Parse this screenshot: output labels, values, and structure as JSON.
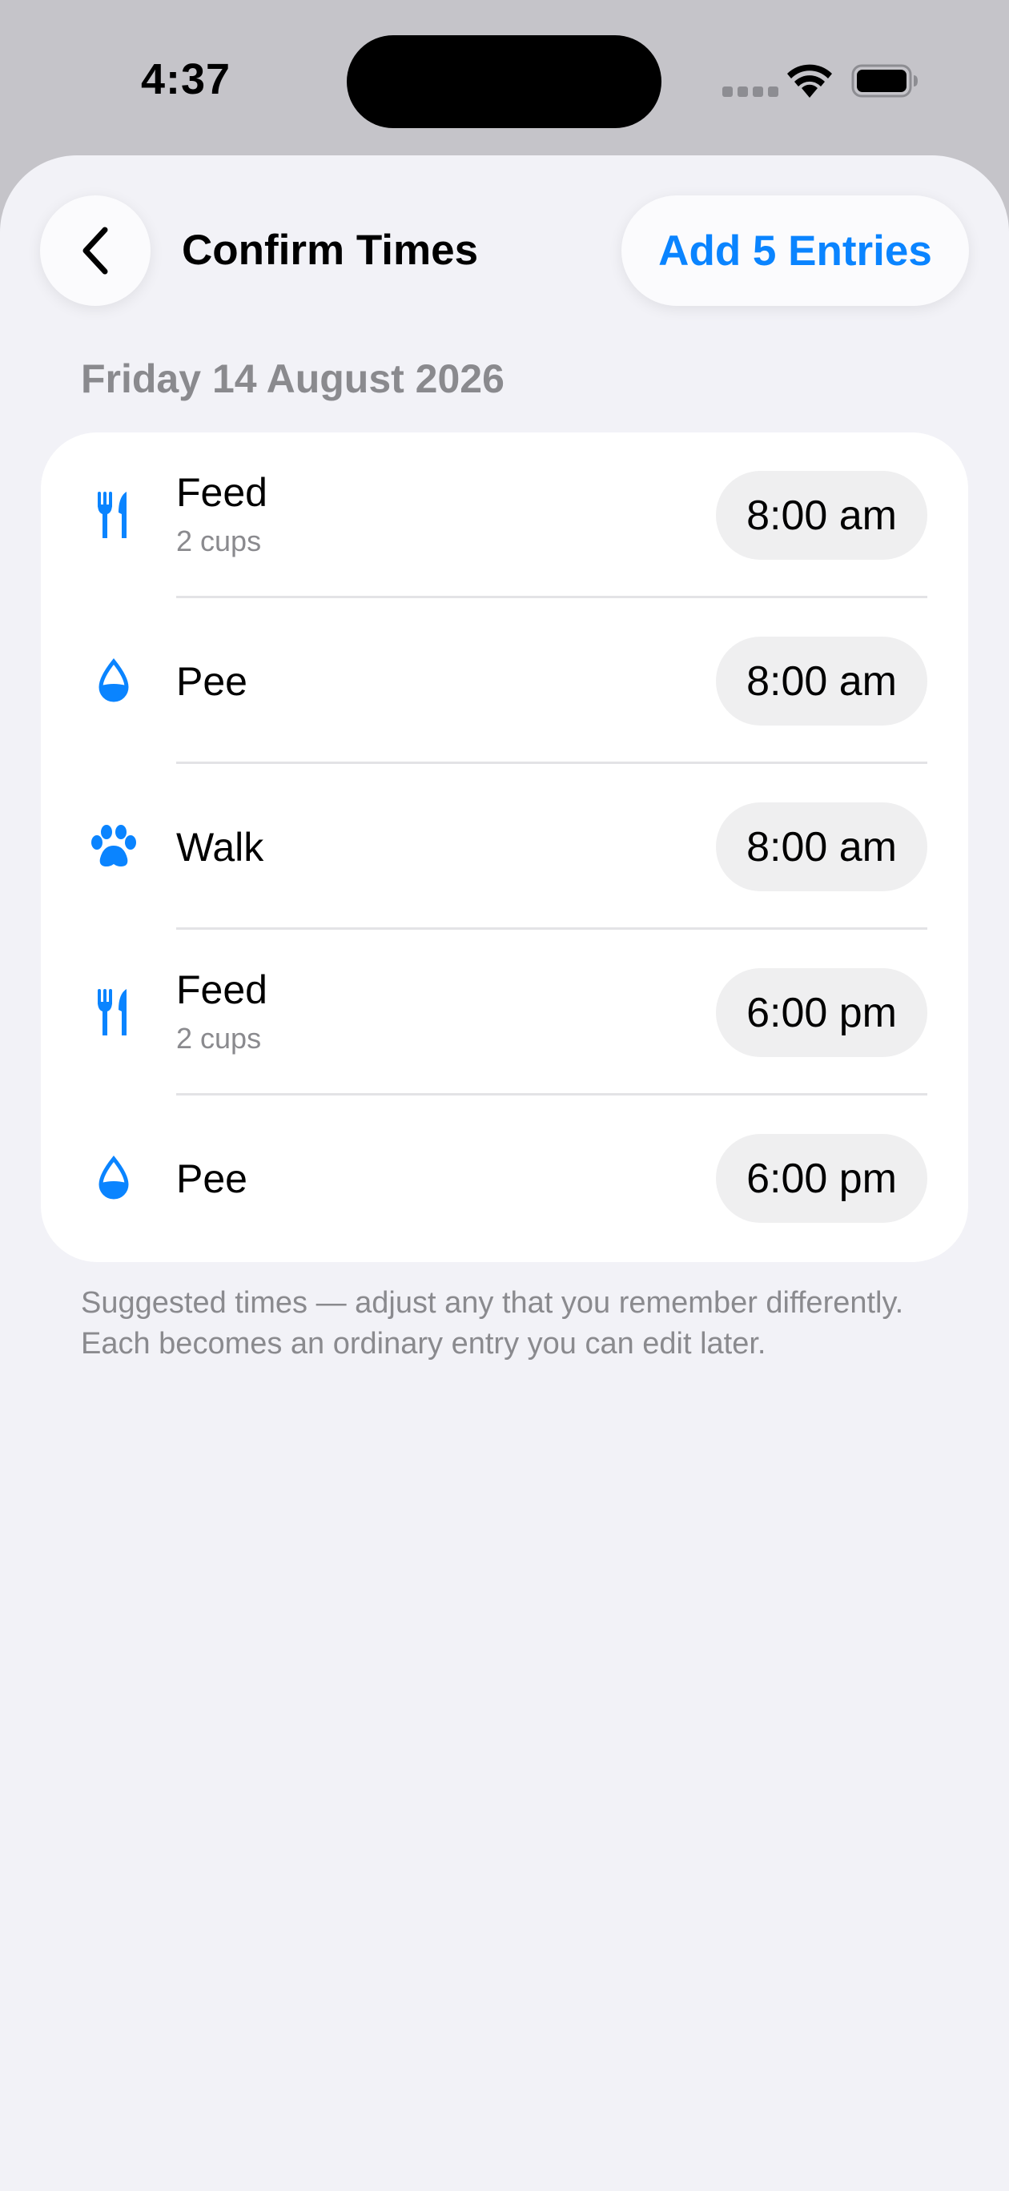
{
  "status_bar": {
    "time": "4:37"
  },
  "header": {
    "title": "Confirm Times",
    "back_icon": "chevron-left-icon",
    "add_label": "Add 5 Entries"
  },
  "date_heading": "Friday 14 August 2026",
  "entries": [
    {
      "icon": "fork-knife-icon",
      "title": "Feed",
      "subtitle": "2 cups",
      "time": "8:00 am"
    },
    {
      "icon": "drop-icon",
      "title": "Pee",
      "subtitle": "",
      "time": "8:00 am"
    },
    {
      "icon": "paw-icon",
      "title": "Walk",
      "subtitle": "",
      "time": "8:00 am"
    },
    {
      "icon": "fork-knife-icon",
      "title": "Feed",
      "subtitle": "2 cups",
      "time": "6:00 pm"
    },
    {
      "icon": "drop-icon",
      "title": "Pee",
      "subtitle": "",
      "time": "6:00 pm"
    }
  ],
  "footnote": "Suggested times — adjust any that you remember differently. Each becomes an ordinary entry you can edit later.",
  "colors": {
    "accent": "#0a84ff",
    "background": "#f2f2f7",
    "secondary_text": "#8a8a8e"
  }
}
